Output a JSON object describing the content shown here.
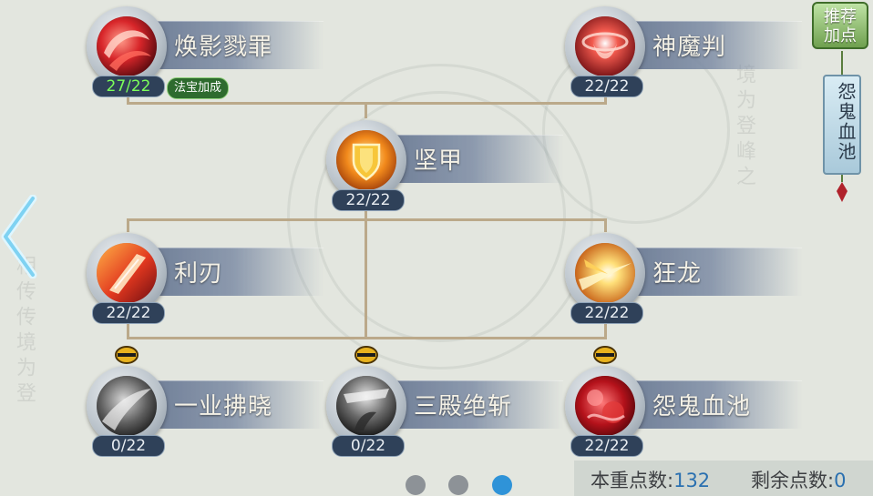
{
  "skills": [
    {
      "name": "焕影戮罪",
      "count": "27/22",
      "badge": "法宝加成",
      "icon": "red-swirl-icon"
    },
    {
      "name": "神魔判",
      "count": "22/22",
      "icon": "red-vortex-icon"
    },
    {
      "name": "坚甲",
      "count": "22/22",
      "icon": "shield-icon"
    },
    {
      "name": "利刃",
      "count": "22/22",
      "icon": "blade-icon"
    },
    {
      "name": "狂龙",
      "count": "22/22",
      "icon": "burst-icon"
    },
    {
      "name": "一业拂晓",
      "count": "0/22",
      "icon": "grey-slash-icon",
      "locked": true
    },
    {
      "name": "三殿绝斩",
      "count": "0/22",
      "icon": "grey-strike-icon",
      "locked": true
    },
    {
      "name": "怨鬼血池",
      "count": "22/22",
      "icon": "blood-pool-icon",
      "locked": true
    }
  ],
  "sidebar": {
    "recommend_label_line1": "推荐",
    "recommend_label_line2": "加点",
    "tab_label": "怨鬼血池"
  },
  "footer": {
    "spent_label": "本重点数:",
    "spent_value": "132",
    "remaining_label": "剩余点数:",
    "remaining_value": "0"
  },
  "pagination": {
    "pages": 3,
    "active_page": 3
  },
  "colors": {
    "accent_green": "#7cff5a",
    "active_dot": "#2f93d8",
    "connector": "#bba98a"
  }
}
